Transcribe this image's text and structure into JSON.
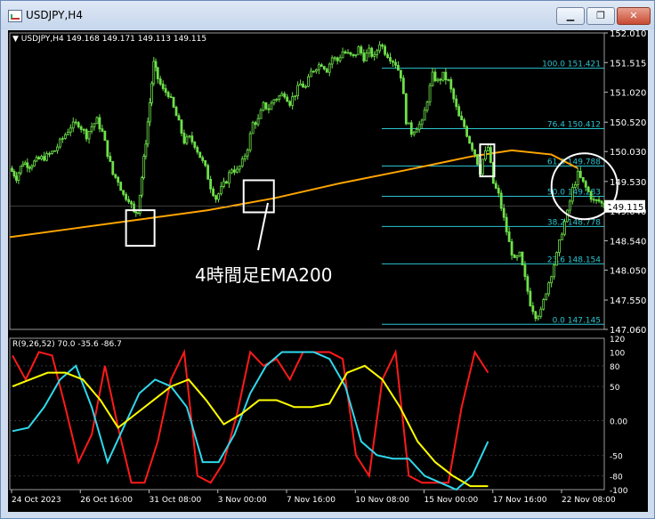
{
  "window": {
    "title": "USDJPY,H4",
    "min_glyph": "▁",
    "max_glyph": "❐",
    "close_glyph": "✕"
  },
  "chart_data": {
    "type": "candlestick",
    "symbol_info": "▼ USDJPY,H4  149.168 149.171 149.113 149.115",
    "ylim": [
      147.06,
      152.01
    ],
    "y_ticks": [
      "152.010",
      "151.515",
      "151.020",
      "150.520",
      "150.030",
      "149.530",
      "149.040",
      "148.540",
      "148.050",
      "147.550",
      "147.060"
    ],
    "current_price": "149.115",
    "x_labels": [
      "24 Oct 2023",
      "26 Oct 16:00",
      "31 Oct 08:00",
      "3 Nov 00:00",
      "7 Nov 16:00",
      "10 Nov 08:00",
      "15 Nov 00:00",
      "17 Nov 16:00",
      "22 Nov 08:00"
    ],
    "price_path": [
      [
        0,
        149.75
      ],
      [
        5,
        149.6
      ],
      [
        10,
        149.85
      ],
      [
        15,
        149.8
      ],
      [
        22,
        149.9
      ],
      [
        28,
        149.95
      ],
      [
        34,
        150.05
      ],
      [
        40,
        150.25
      ],
      [
        46,
        150.45
      ],
      [
        52,
        150.5
      ],
      [
        58,
        150.3
      ],
      [
        62,
        150.45
      ],
      [
        66,
        150.55
      ],
      [
        70,
        150.35
      ],
      [
        74,
        150.0
      ],
      [
        78,
        149.65
      ],
      [
        82,
        149.55
      ],
      [
        86,
        149.3
      ],
      [
        90,
        149.25
      ],
      [
        94,
        149.0
      ],
      [
        97,
        149.05
      ],
      [
        100,
        149.6
      ],
      [
        103,
        150.2
      ],
      [
        106,
        150.85
      ],
      [
        109,
        151.5
      ],
      [
        112,
        151.25
      ],
      [
        116,
        151.05
      ],
      [
        120,
        151.0
      ],
      [
        124,
        150.75
      ],
      [
        128,
        150.5
      ],
      [
        132,
        150.2
      ],
      [
        136,
        150.25
      ],
      [
        140,
        150.15
      ],
      [
        144,
        149.95
      ],
      [
        148,
        149.75
      ],
      [
        152,
        149.45
      ],
      [
        156,
        149.25
      ],
      [
        160,
        149.4
      ],
      [
        164,
        149.55
      ],
      [
        168,
        149.75
      ],
      [
        172,
        149.7
      ],
      [
        176,
        149.85
      ],
      [
        180,
        150.1
      ],
      [
        184,
        150.5
      ],
      [
        188,
        150.55
      ],
      [
        192,
        150.8
      ],
      [
        196,
        150.75
      ],
      [
        200,
        150.9
      ],
      [
        204,
        150.95
      ],
      [
        208,
        151.0
      ],
      [
        212,
        150.85
      ],
      [
        216,
        151.0
      ],
      [
        220,
        151.15
      ],
      [
        224,
        151.1
      ],
      [
        228,
        151.35
      ],
      [
        232,
        151.45
      ],
      [
        236,
        151.5
      ],
      [
        240,
        151.4
      ],
      [
        244,
        151.6
      ],
      [
        248,
        151.55
      ],
      [
        252,
        151.7
      ],
      [
        256,
        151.65
      ],
      [
        260,
        151.6
      ],
      [
        264,
        151.75
      ],
      [
        268,
        151.6
      ],
      [
        272,
        151.7
      ],
      [
        276,
        151.6
      ],
      [
        280,
        151.85
      ],
      [
        284,
        151.7
      ],
      [
        288,
        151.6
      ],
      [
        292,
        151.5
      ],
      [
        296,
        151.3
      ],
      [
        298,
        150.95
      ],
      [
        300,
        150.55
      ],
      [
        304,
        150.35
      ],
      [
        308,
        150.45
      ],
      [
        312,
        150.5
      ],
      [
        316,
        150.9
      ],
      [
        320,
        151.3
      ],
      [
        324,
        151.2
      ],
      [
        328,
        151.3
      ],
      [
        332,
        151.2
      ],
      [
        336,
        150.9
      ],
      [
        340,
        150.6
      ],
      [
        344,
        150.45
      ],
      [
        348,
        150.2
      ],
      [
        352,
        150.0
      ],
      [
        356,
        149.7
      ],
      [
        358,
        149.9
      ],
      [
        362,
        150.1
      ],
      [
        366,
        149.5
      ],
      [
        370,
        149.3
      ],
      [
        374,
        148.9
      ],
      [
        378,
        148.5
      ],
      [
        382,
        148.2
      ],
      [
        386,
        148.3
      ],
      [
        390,
        147.9
      ],
      [
        394,
        147.5
      ],
      [
        398,
        147.3
      ],
      [
        402,
        147.35
      ],
      [
        406,
        147.7
      ],
      [
        410,
        148.0
      ],
      [
        414,
        148.3
      ],
      [
        418,
        148.7
      ],
      [
        422,
        149.0
      ],
      [
        426,
        149.4
      ],
      [
        430,
        149.65
      ],
      [
        434,
        149.5
      ],
      [
        438,
        149.35
      ],
      [
        442,
        149.2
      ],
      [
        446,
        149.2
      ],
      [
        450,
        149.12
      ]
    ],
    "ema200": {
      "label": "4時間足EMA200",
      "color": "#ffa500",
      "points": [
        [
          0,
          148.6
        ],
        [
          50,
          148.75
        ],
        [
          100,
          148.9
        ],
        [
          150,
          149.05
        ],
        [
          200,
          149.25
        ],
        [
          250,
          149.5
        ],
        [
          300,
          149.72
        ],
        [
          350,
          149.95
        ],
        [
          380,
          150.05
        ],
        [
          410,
          149.98
        ],
        [
          430,
          149.75
        ]
      ]
    },
    "fibonacci": {
      "color": "#2bc4cf",
      "levels": [
        {
          "label": "100.0  151.421",
          "price": 151.421
        },
        {
          "label": "76.4  150.412",
          "price": 150.412
        },
        {
          "label": "61.8  149.788",
          "price": 149.788
        },
        {
          "label": "50.0  149.283",
          "price": 149.283
        },
        {
          "label": "38.2  148.778",
          "price": 148.778
        },
        {
          "label": "23.6  148.154",
          "price": 148.154
        },
        {
          "label": "0.0  147.145",
          "price": 147.145
        }
      ]
    },
    "indicator": {
      "label": "R(9,26,52) 70.0 -35.6 -86.7",
      "ylim": [
        -100,
        120
      ],
      "y_ticks": [
        "120",
        "100",
        "80",
        "50",
        "0.00",
        "-50",
        "-80",
        "-100"
      ],
      "series": [
        {
          "color": "#ff1a1a",
          "values": [
            95,
            60,
            100,
            95,
            20,
            -60,
            -20,
            80,
            -10,
            -90,
            -90,
            -30,
            60,
            100,
            -80,
            -90,
            -60,
            10,
            100,
            80,
            90,
            60,
            100,
            100,
            100,
            90,
            -50,
            -80,
            60,
            100,
            -80,
            -90,
            -90,
            -90,
            20,
            100,
            70
          ]
        },
        {
          "color": "#2fd8ec",
          "values": [
            -15,
            -10,
            20,
            60,
            80,
            20,
            -60,
            -10,
            40,
            60,
            50,
            20,
            -60,
            -60,
            -20,
            40,
            80,
            100,
            100,
            100,
            90,
            50,
            -30,
            -50,
            -55,
            -55,
            -80,
            -90,
            -100,
            -80,
            -30
          ]
        },
        {
          "color": "#ffff00",
          "values": [
            50,
            60,
            70,
            70,
            60,
            30,
            -10,
            10,
            30,
            50,
            60,
            30,
            -5,
            10,
            30,
            30,
            20,
            20,
            25,
            70,
            80,
            60,
            20,
            -30,
            -60,
            -80,
            -95,
            -95
          ]
        }
      ]
    },
    "annotation": "4時間足EMA200"
  }
}
